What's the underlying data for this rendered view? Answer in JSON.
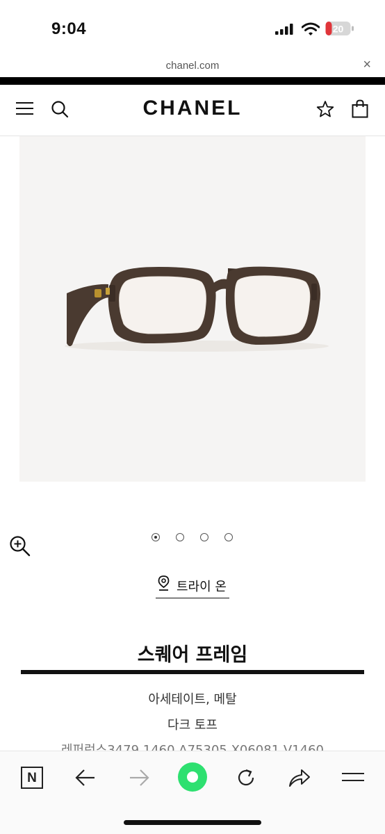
{
  "status_bar": {
    "time": "9:04",
    "battery_level": "20",
    "icons": [
      "cellular-signal-icon",
      "wifi-icon",
      "battery-icon"
    ]
  },
  "browser": {
    "url": "chanel.com",
    "close_symbol": "×"
  },
  "header": {
    "logo": "CHANEL",
    "icons": [
      "hamburger-menu-icon",
      "search-icon",
      "wishlist-star-icon",
      "shopping-bag-icon"
    ]
  },
  "product": {
    "image_alt_icon": "eyeglasses",
    "gallery_count": 4,
    "gallery_active": 1,
    "try_on_label": "트라이 온",
    "name": "스퀘어 프레임",
    "material": "아세테이트, 메탈",
    "color": "다크 토프",
    "reference": "레퍼런스3479 1460   A75305 X06081 V1460"
  },
  "toolbar": {
    "n_button": "N",
    "icons": [
      "n-icon",
      "back-arrow-icon",
      "forward-arrow-icon",
      "home-dot-icon",
      "reload-icon",
      "share-icon",
      "menu-icon"
    ]
  },
  "colors": {
    "brand_black": "#111111",
    "toolbar_green": "#2ee070",
    "battery_red": "#e0353a",
    "frame_brown": "#4a3a30"
  }
}
